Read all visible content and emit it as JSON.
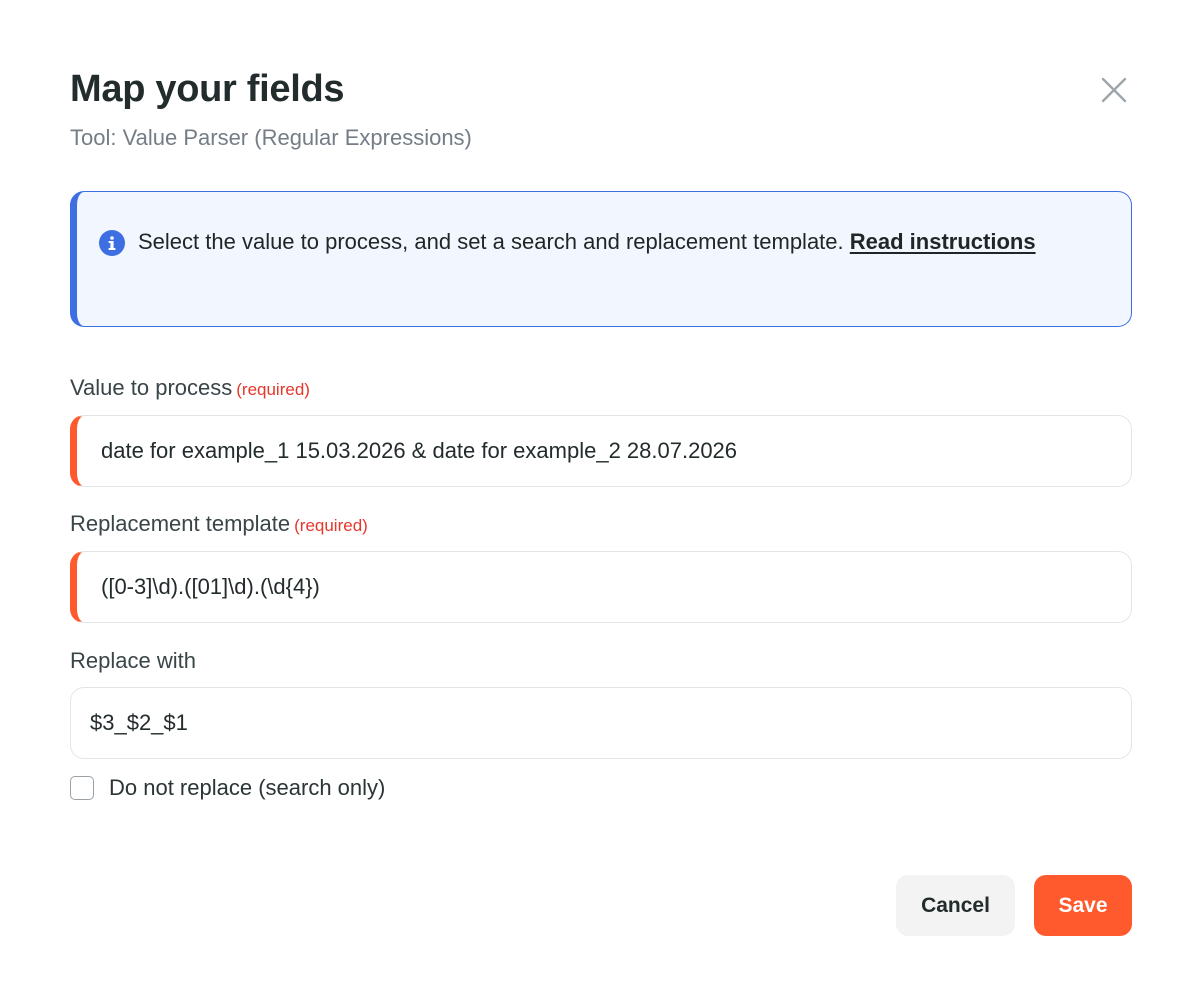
{
  "dialog": {
    "title": "Map your fields",
    "subtitle": "Tool: Value Parser (Regular Expressions)"
  },
  "info": {
    "text": "Select the value to process, and set a search and replacement template. ",
    "link": "Read instructions"
  },
  "fields": {
    "value_to_process": {
      "label": "Value to process",
      "required_tag": "(required)",
      "value": "date for example_1 15.03.2026 & date for example_2 28.07.2026"
    },
    "replacement_template": {
      "label": "Replacement template",
      "required_tag": "(required)",
      "value": "([0-3]\\d).([01]\\d).(\\d{4})"
    },
    "replace_with": {
      "label": "Replace with",
      "value": "$3_$2_$1"
    }
  },
  "checkbox": {
    "label": "Do not replace (search only)",
    "checked": false
  },
  "buttons": {
    "cancel": "Cancel",
    "save": "Save"
  },
  "colors": {
    "accent": "#fe5a2e",
    "info_blue": "#3d6fe3",
    "required_red": "#e5372b"
  },
  "icons": {
    "close": "close-icon",
    "info": "info-icon"
  }
}
